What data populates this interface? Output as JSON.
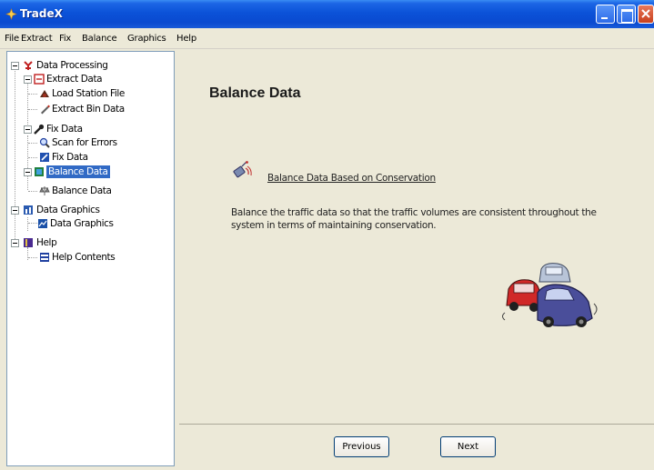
{
  "window": {
    "title": "TradeX"
  },
  "menu": [
    "File",
    "Extract",
    "Fix",
    "Balance",
    "Graphics",
    "Help"
  ],
  "tree": {
    "data_processing": "Data Processing",
    "extract_data": "Extract Data",
    "load_station_file": "Load Station File",
    "extract_bin_data": "Extract Bin Data",
    "fix_data": "Fix Data",
    "scan_for_errors": "Scan for Errors",
    "fix_data_child": "Fix Data",
    "balance_data": "Balance Data",
    "balance_data_child": "Balance Data",
    "data_graphics": "Data Graphics",
    "data_graphics_child": "Data Graphics",
    "help": "Help",
    "help_contents": "Help Contents"
  },
  "main": {
    "title": "Balance Data",
    "link_label": "Balance Data Based on Conservation",
    "description": "Balance the traffic data so that the traffic volumes are consistent throughout the system in terms of maintaining conservation."
  },
  "buttons": {
    "previous": "Previous",
    "next": "Next"
  },
  "colors": {
    "titlebar": "#0a4ad0",
    "selection": "#316ac5",
    "panel": "#ece9d8"
  }
}
